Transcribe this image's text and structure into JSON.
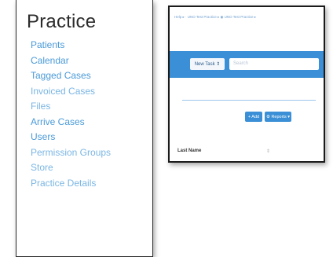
{
  "sidebar": {
    "title": "Practice",
    "items": [
      {
        "label": "Patients"
      },
      {
        "label": "Calendar"
      },
      {
        "label": "Tagged Cases"
      },
      {
        "label": "Invoiced Cases"
      },
      {
        "label": "Files"
      },
      {
        "label": "Arrive Cases"
      },
      {
        "label": "Users"
      },
      {
        "label": "Permission Groups"
      },
      {
        "label": "Store"
      },
      {
        "label": "Practice Details"
      }
    ]
  },
  "preview": {
    "breadcrumb": "Help ▸ · UNO Test Practice ▸ ◉ UNO Test Practice ▸",
    "new_task_label": "New Task ⇕",
    "search_placeholder": "Search",
    "add_label": "+ Add",
    "reports_label": "⚙ Reports ▾",
    "column_header": "Last Name",
    "sort_glyph": "⇕"
  },
  "colors": {
    "link": "#4a9ad8",
    "toolbar": "#3a8fd6"
  }
}
